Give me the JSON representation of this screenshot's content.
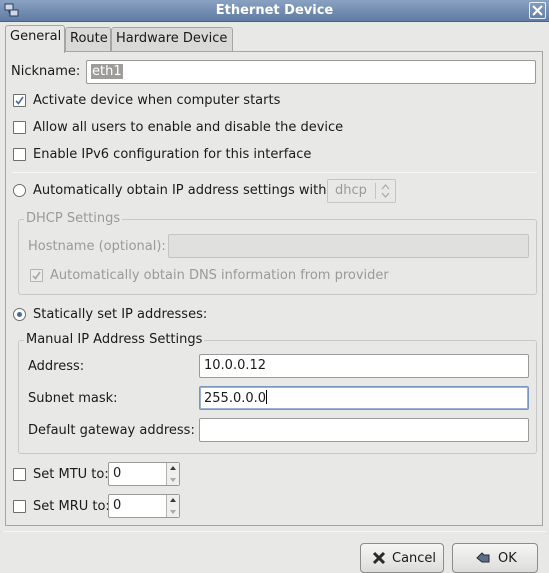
{
  "window": {
    "title": "Ethernet Device",
    "icon": "network-device-icon",
    "close_icon": "close-icon"
  },
  "tabs": [
    {
      "label": "General",
      "active": true
    },
    {
      "label": "Route",
      "active": false
    },
    {
      "label": "Hardware Device",
      "active": false
    }
  ],
  "general": {
    "nickname_label": "Nickname:",
    "nickname_value": "eth1",
    "activate_on_start": {
      "label": "Activate device when computer starts",
      "checked": true
    },
    "allow_users": {
      "label": "Allow all users to enable and disable the device",
      "checked": false
    },
    "enable_ipv6": {
      "label": "Enable IPv6 configuration for this interface",
      "checked": false
    },
    "auto_obtain": {
      "label": "Automatically obtain IP address settings with:",
      "selected": false,
      "protocol": "dhcp"
    },
    "dhcp": {
      "frame_title": "DHCP Settings",
      "hostname_label": "Hostname (optional):",
      "hostname_value": "",
      "auto_dns": {
        "label": "Automatically obtain DNS information from provider",
        "checked": true
      }
    },
    "static": {
      "label": "Statically set IP addresses:",
      "selected": true
    },
    "manual": {
      "frame_title": "Manual IP Address Settings",
      "address_label": "Address:",
      "address_value": "10.0.0.12",
      "subnet_label": "Subnet mask:",
      "subnet_value": "255.0.0.0",
      "gateway_label": "Default gateway address:",
      "gateway_value": ""
    },
    "mtu": {
      "label": "Set MTU to:",
      "checked": false,
      "value": "0"
    },
    "mru": {
      "label": "Set MRU to:",
      "checked": false,
      "value": "0"
    }
  },
  "buttons": {
    "cancel": {
      "label": "Cancel",
      "icon": "cancel-x-icon"
    },
    "ok": {
      "label": "OK",
      "icon": "ok-hand-icon"
    }
  }
}
